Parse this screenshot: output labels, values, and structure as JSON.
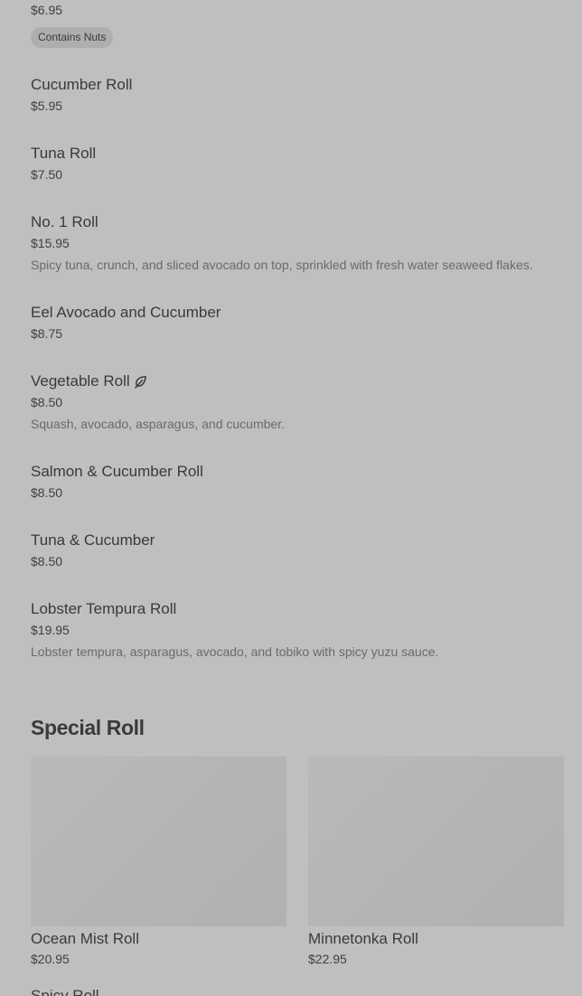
{
  "top_item": {
    "price": "$6.95",
    "tag": "Contains Nuts"
  },
  "items": [
    {
      "name": "Cucumber Roll",
      "price": "$5.95"
    },
    {
      "name": "Tuna Roll",
      "price": "$7.50"
    },
    {
      "name": "No. 1 Roll",
      "price": "$15.95",
      "description": "Spicy tuna, crunch, and sliced avocado on top, sprinkled with fresh water seaweed flakes."
    },
    {
      "name": "Eel Avocado and Cucumber",
      "price": "$8.75"
    },
    {
      "name": "Vegetable Roll",
      "price": "$8.50",
      "description": "Squash, avocado, asparagus, and cucumber.",
      "icon": "vegetarian-leaf-icon"
    },
    {
      "name": "Salmon & Cucumber Roll",
      "price": "$8.50"
    },
    {
      "name": "Tuna & Cucumber",
      "price": "$8.50"
    },
    {
      "name": "Lobster Tempura Roll",
      "price": "$19.95",
      "description": "Lobster tempura, asparagus, avocado, and tobiko with spicy yuzu sauce."
    }
  ],
  "special_section": {
    "title": "Special Roll",
    "cards": [
      {
        "name": "Ocean Mist Roll",
        "price": "$20.95"
      },
      {
        "name": "Minnetonka Roll",
        "price": "$22.95"
      }
    ],
    "next_item_name": "Spicy Roll"
  },
  "colors": {
    "overlay_background": "#bfbfbf",
    "text": "#3a3a3a",
    "description_text": "#6a6a6a",
    "tag_background": "#aeaeae"
  }
}
